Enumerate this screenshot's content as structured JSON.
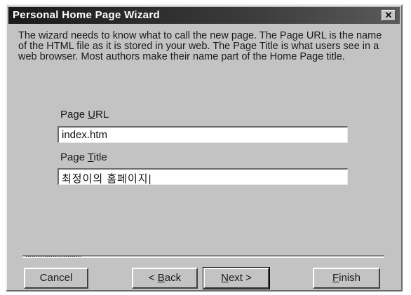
{
  "window": {
    "title": "Personal Home Page Wizard",
    "close_glyph": "✕"
  },
  "description": "The wizard needs to know what to call the new page. The Page URL is the name of the HTML file as it is stored in your web. The Page Title is what users see in a web browser. Most authors make their name part of the Home Page title.",
  "page_url": {
    "label_before": "Page ",
    "label_accel": "U",
    "label_after": "RL",
    "value": "index.htm"
  },
  "page_title": {
    "label_before": "Page ",
    "label_accel": "T",
    "label_after": "itle",
    "value": "최정이의 홈페이지|"
  },
  "buttons": {
    "cancel": "Cancel",
    "back_prefix": "< ",
    "back_accel": "B",
    "back_rest": "ack",
    "next_accel": "N",
    "next_rest": "ext >",
    "finish_accel": "F",
    "finish_rest": "inish"
  }
}
